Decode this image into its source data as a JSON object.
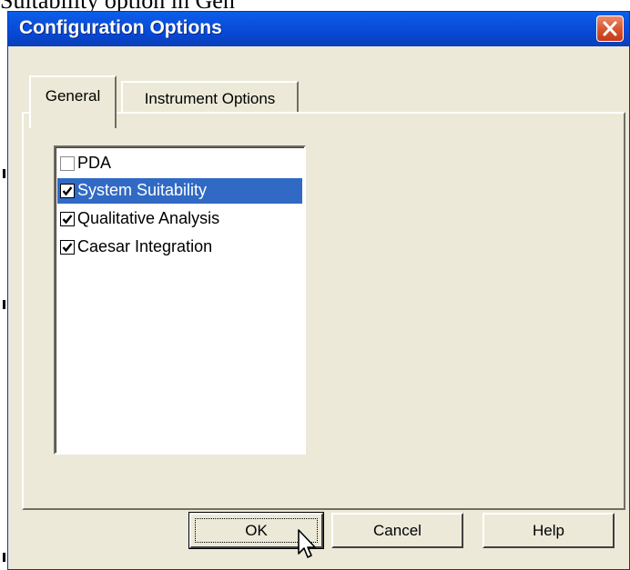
{
  "background": {
    "caption_fragment": "Suitability option in Gen"
  },
  "window": {
    "title": "Configuration Options",
    "title_bar_color": "#0A5FEA",
    "close_icon": "close-icon"
  },
  "tabs": [
    {
      "label": "General",
      "active": true
    },
    {
      "label": "Instrument Options",
      "active": false
    }
  ],
  "list": {
    "items": [
      {
        "label": "PDA",
        "checked": false,
        "selected": false
      },
      {
        "label": "System Suitability",
        "checked": true,
        "selected": true
      },
      {
        "label": "Qualitative Analysis",
        "checked": true,
        "selected": false
      },
      {
        "label": "Caesar Integration",
        "checked": true,
        "selected": false
      }
    ],
    "selection_color": "#316AC5"
  },
  "buttons": {
    "ok": "OK",
    "cancel": "Cancel",
    "help": "Help"
  },
  "cursor": {
    "icon": "arrow-cursor-icon"
  }
}
